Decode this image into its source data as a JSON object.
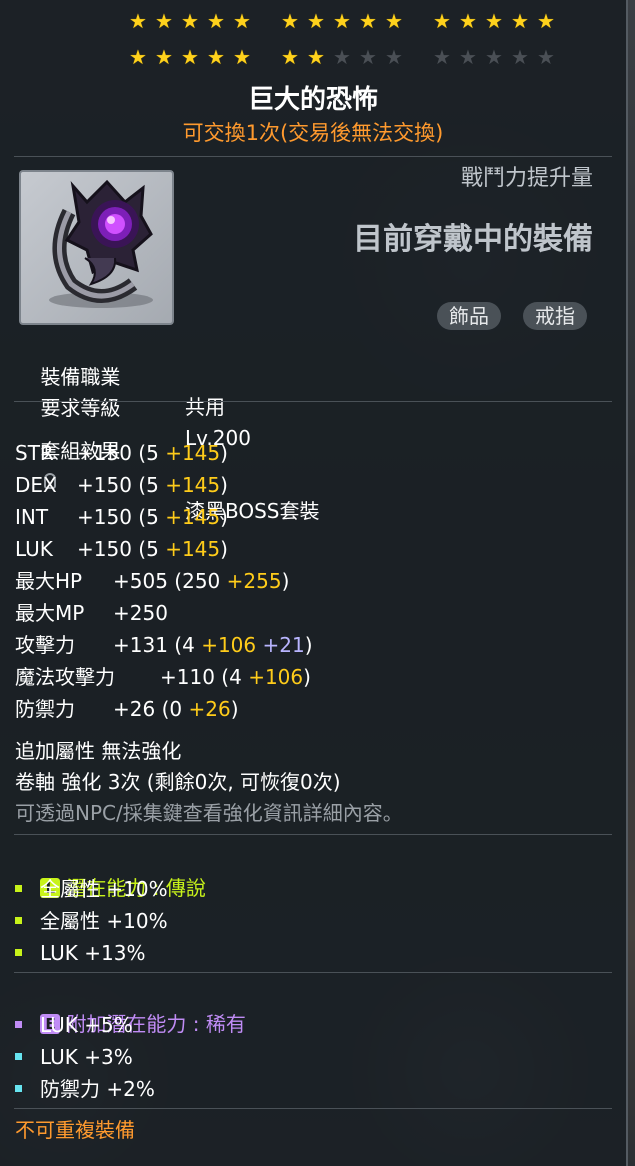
{
  "stars": {
    "row1": [
      1,
      1,
      1,
      1,
      1,
      1,
      1,
      1,
      1,
      1,
      1,
      1,
      1,
      1,
      1
    ],
    "row2": [
      1,
      1,
      1,
      1,
      1,
      1,
      1,
      0,
      0,
      0,
      0,
      0,
      0,
      0,
      0
    ],
    "glyph": "★"
  },
  "item": {
    "name": "巨大的恐怖",
    "trade_note": "可交換1次(交易後無法交換)",
    "icon": "dark-ring-icon"
  },
  "compare": {
    "cp_label": "戰鬥力提升量",
    "current_equip": "目前穿戴中的裝備",
    "tags": [
      "飾品",
      "戒指"
    ]
  },
  "requirements": {
    "job_label": "裝備職業",
    "job_value": "共用",
    "level_label": "要求等級",
    "level_value": "Lv.200"
  },
  "set": {
    "label": "套組效果",
    "value": "漆黑BOSS套裝"
  },
  "stats": [
    {
      "name": "STR",
      "total": "+150",
      "open": " (5 ",
      "bonus1": "+145",
      "bonus2": "",
      "close": ")"
    },
    {
      "name": "DEX",
      "total": "+150",
      "open": " (5 ",
      "bonus1": "+145",
      "bonus2": "",
      "close": ")"
    },
    {
      "name": "INT",
      "total": "+150",
      "open": " (5 ",
      "bonus1": "+145",
      "bonus2": "",
      "close": ")"
    },
    {
      "name": "LUK",
      "total": "+150",
      "open": " (5 ",
      "bonus1": "+145",
      "bonus2": "",
      "close": ")"
    },
    {
      "name": "最大HP",
      "total": "+505",
      "open": " (250 ",
      "bonus1": "+255",
      "bonus2": "",
      "close": ")"
    },
    {
      "name": "最大MP",
      "total": "+250",
      "open": "",
      "bonus1": "",
      "bonus2": "",
      "close": ""
    },
    {
      "name": "攻擊力",
      "total": "+131",
      "open": " (4 ",
      "bonus1": "+106",
      "bonus2": " +21",
      "close": ")"
    },
    {
      "name": "魔法攻擊力",
      "total": "+110",
      "open": " (4 ",
      "bonus1": "+106",
      "bonus2": "",
      "close": ")"
    },
    {
      "name": "防禦力",
      "total": "+26",
      "open": " (0 ",
      "bonus1": "+26",
      "bonus2": "",
      "close": ")"
    }
  ],
  "extra": {
    "additional": "追加屬性 無法強化",
    "scroll": "卷軸 強化 3次 (剩餘0次, 可恢復0次)",
    "hint": "可透過NPC/採集鍵查看強化資訊詳細內容。"
  },
  "potential": {
    "badge": "L",
    "title": "潛在能力 : 傳說",
    "color": "#c8f31a",
    "lines": [
      "全屬性 +10%",
      "全屬性 +10%",
      "LUK +13%"
    ]
  },
  "bonus_potential": {
    "badge": "E",
    "title": "附加潛在能力 : 稀有",
    "color": "#c08cf5",
    "lines": [
      {
        "text": "LUK +5%",
        "color": "#c08cf5"
      },
      {
        "text": "LUK +3%",
        "color": "#67e4f0"
      },
      {
        "text": "防禦力 +2%",
        "color": "#67e4f0"
      }
    ]
  },
  "footer": {
    "unique": "不可重複裝備"
  }
}
